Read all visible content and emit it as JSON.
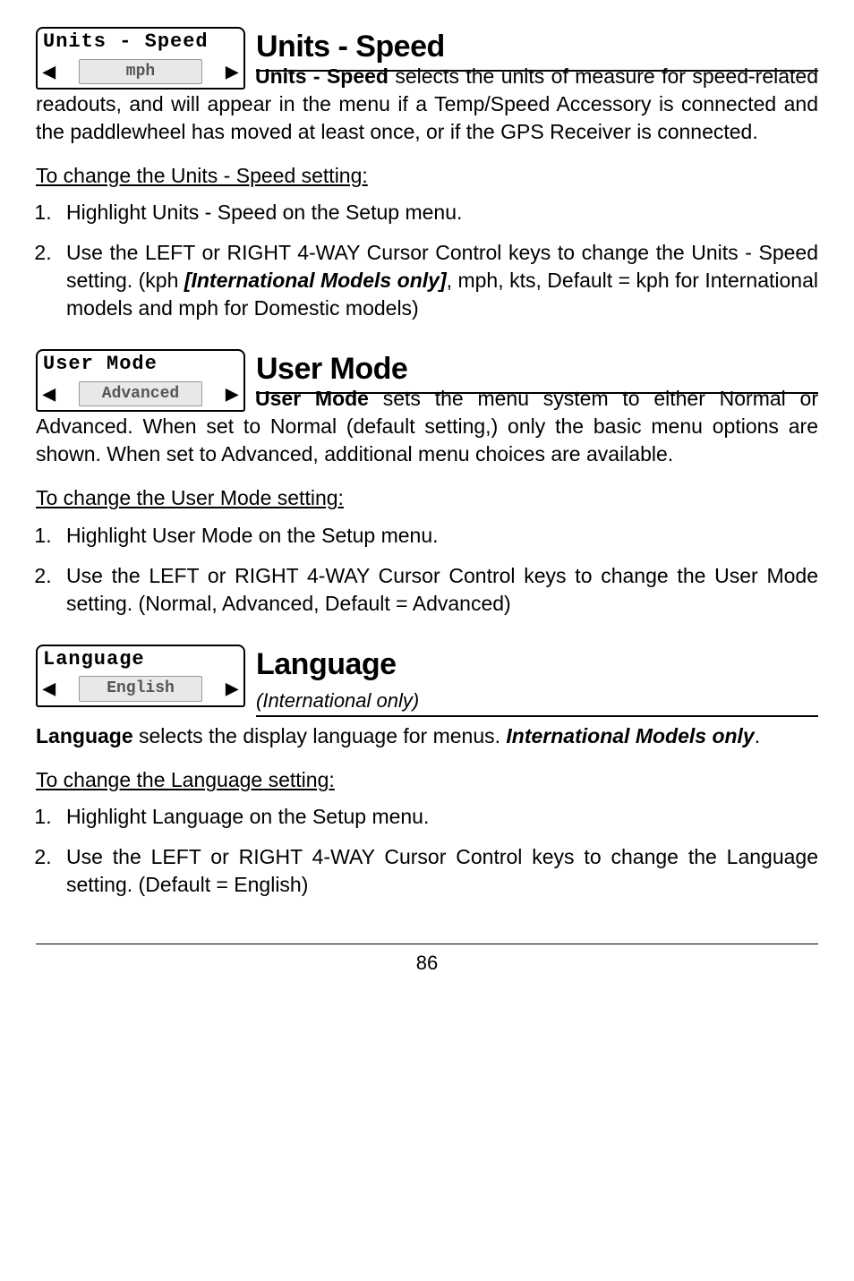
{
  "sections": [
    {
      "widget": {
        "title": "Units - Speed",
        "value": "mph"
      },
      "heading": "Units - Speed",
      "subheading": "",
      "para_lead": "Units - Speed",
      "para_rest": " selects the units of measure for speed-related readouts, and will appear in the menu if a Temp/Speed Accessory is connected and the paddlewheel has moved at least once, or if the GPS Receiver is connected.",
      "proc_title": "To change the Units - Speed setting:",
      "steps": [
        "Highlight Units - Speed on the Setup menu.",
        "Use the LEFT or RIGHT 4-WAY Cursor Control keys to change the Units - Speed setting. (kph <span class=\"ital\">[International Models only]</span>, mph, kts, Default = kph for International models and mph for Domestic models)"
      ]
    },
    {
      "widget": {
        "title": "User Mode",
        "value": "Advanced"
      },
      "heading": "User Mode",
      "subheading": "",
      "para_lead": "User Mode",
      "para_rest": " sets the menu system to either Normal or Advanced. When set to Normal (default setting,) only the basic menu options are shown. When set to Advanced, additional menu choices are available.",
      "proc_title": "To change the User Mode setting:",
      "steps": [
        "Highlight User Mode on the Setup menu.",
        "Use the LEFT or RIGHT 4-WAY Cursor Control keys to change the User Mode setting. (Normal, Advanced, Default = Advanced)"
      ]
    },
    {
      "widget": {
        "title": "Language",
        "value": "English"
      },
      "heading": "Language",
      "subheading": "(International only)",
      "pre_para": "<span class=\"lead-bold\">Language</span> selects the display language for menus. <span class=\"ital\">International Models only</span>.",
      "proc_title": "To change the Language setting:",
      "steps": [
        "Highlight Language on the Setup menu.",
        "Use the LEFT or RIGHT 4-WAY Cursor Control keys to change the Language setting. (Default = English)"
      ]
    }
  ],
  "page_number": "86"
}
